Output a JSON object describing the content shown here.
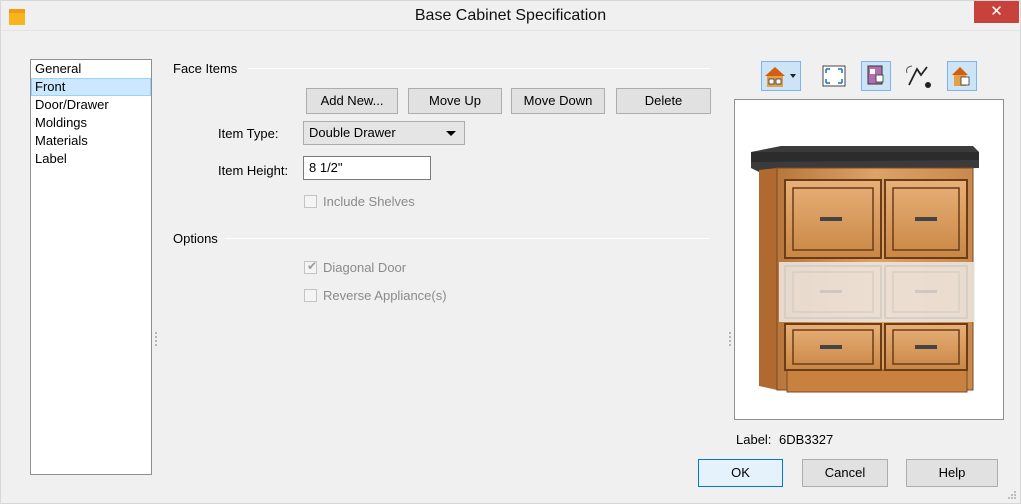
{
  "window": {
    "title": "Base Cabinet Specification",
    "close_glyph": "✕"
  },
  "sidebar": {
    "items": [
      {
        "label": "General",
        "selected": false
      },
      {
        "label": "Front",
        "selected": true
      },
      {
        "label": "Door/Drawer",
        "selected": false
      },
      {
        "label": "Moldings",
        "selected": false
      },
      {
        "label": "Materials",
        "selected": false
      },
      {
        "label": "Label",
        "selected": false
      }
    ]
  },
  "face_items": {
    "group_label": "Face Items",
    "buttons": {
      "add_new": "Add New...",
      "move_up": "Move Up",
      "move_down": "Move Down",
      "delete": "Delete"
    },
    "item_type_label": "Item Type:",
    "item_type_value": "Double Drawer",
    "item_height_label": "Item Height:",
    "item_height_value": "8 1/2\"",
    "include_shelves_label": "Include Shelves",
    "include_shelves_checked": false
  },
  "options": {
    "group_label": "Options",
    "diagonal_door_label": "Diagonal Door",
    "diagonal_door_checked": true,
    "reverse_appliance_label": "Reverse Appliance(s)",
    "reverse_appliance_checked": false
  },
  "preview": {
    "toolbar_icons": [
      "view-type-icon",
      "fill-window-icon",
      "material-fill-icon",
      "spin-tool-icon",
      "reset-view-icon"
    ],
    "label_prefix": "Label:",
    "label_value": "6DB3327"
  },
  "footer": {
    "ok": "OK",
    "cancel": "Cancel",
    "help": "Help"
  },
  "colors": {
    "selection": "#cce8ff",
    "close_button": "#c7423b",
    "cabinet_wood": "#d69a5e",
    "countertop": "#4a4a4a"
  }
}
